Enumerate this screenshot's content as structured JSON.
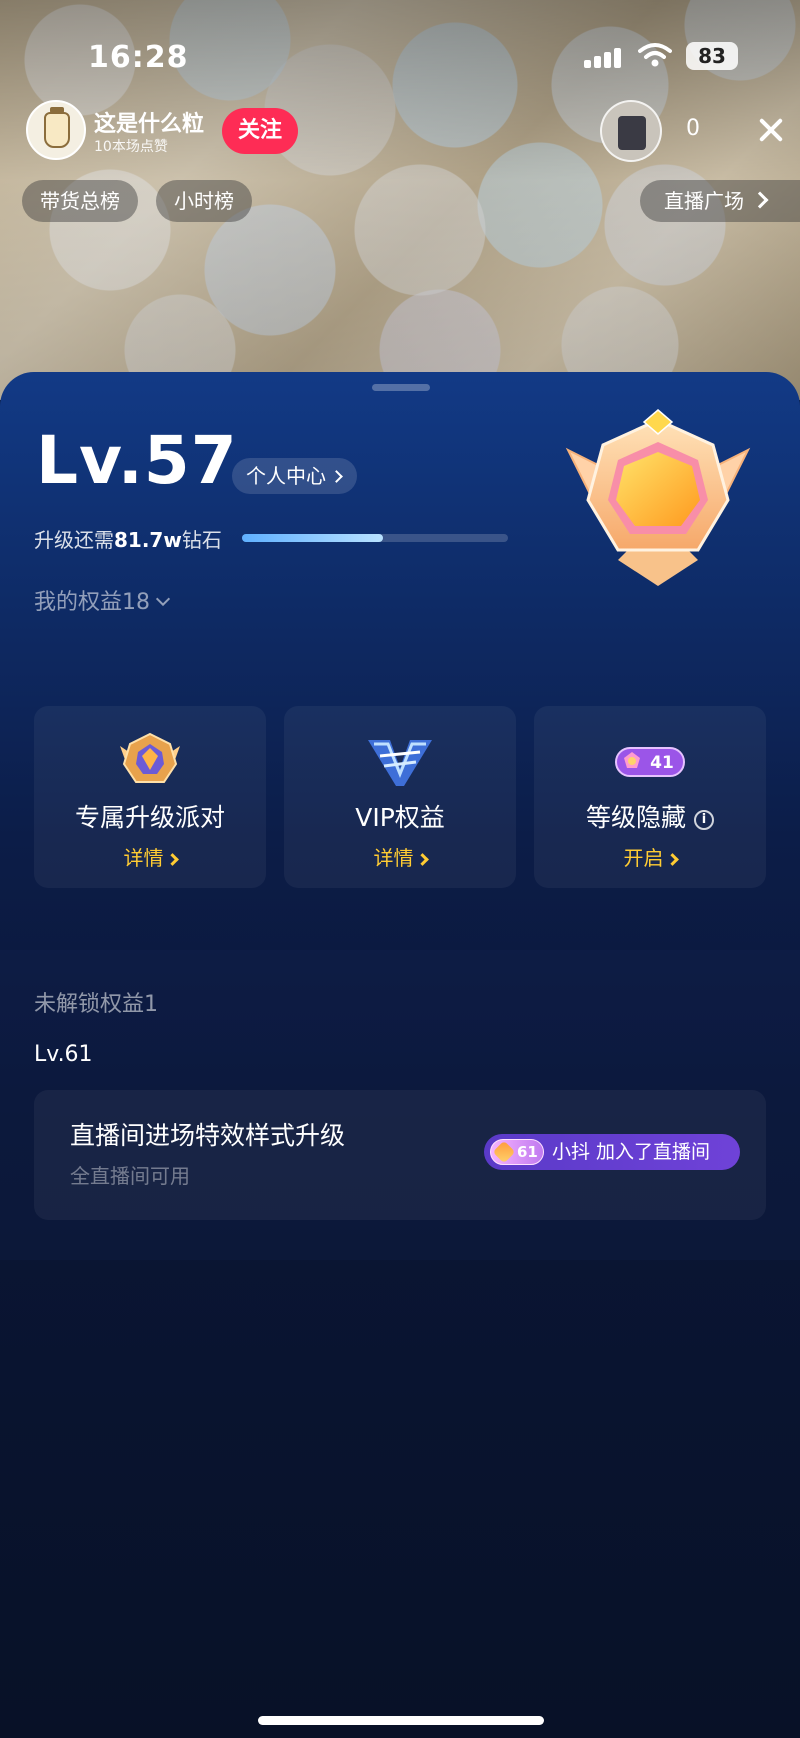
{
  "status_bar": {
    "time": "16:28",
    "battery": "83"
  },
  "streamer": {
    "name": "这是什么粒",
    "subtitle": "10本场点赞",
    "follow_label": "关注"
  },
  "viewers": {
    "count": "0"
  },
  "top_pills": {
    "sales_rank": "带货总榜",
    "hourly_rank": "小时榜",
    "live_plaza": "直播广场"
  },
  "level_panel": {
    "level": "Lv.57",
    "personal_center": "个人中心",
    "upgrade_prefix": "升级还需",
    "upgrade_amount": "81.7w",
    "upgrade_suffix": "钻石",
    "progress_fraction": 0.53
  },
  "my_benefits": {
    "label": "我的权益18",
    "cards": [
      {
        "icon": "level-badge-icon",
        "title": "专属升级派对",
        "action": "详情"
      },
      {
        "icon": "vip-v-icon",
        "title": "VIP权益",
        "action": "详情"
      },
      {
        "icon": "level-41-badge-icon",
        "badge_number": "41",
        "title": "等级隐藏",
        "action": "开启"
      }
    ]
  },
  "locked_benefits": {
    "label": "未解锁权益1",
    "level_tag": "Lv.61",
    "card": {
      "title": "直播间进场特效样式升级",
      "subtitle": "全直播间可用",
      "preview_level": "61",
      "preview_text": "小抖 加入了直播间"
    }
  },
  "colors": {
    "accent_gold": "#ffcc33",
    "follow_pink": "#fe2c55",
    "sheet_top": "#123a86",
    "sheet_bottom": "#081127"
  }
}
